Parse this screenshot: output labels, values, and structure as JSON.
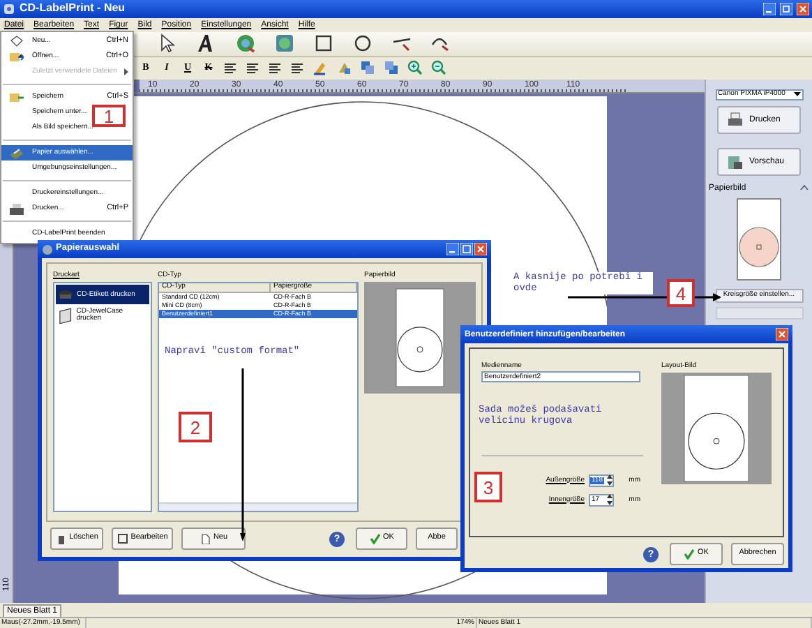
{
  "window": {
    "title": "CD-LabelPrint - Neu"
  },
  "menu_bar": [
    {
      "label": "Datei",
      "selected": true
    },
    {
      "label": "Bearbeiten",
      "selected": false
    },
    {
      "label": "Text",
      "selected": false
    },
    {
      "label": "Figur",
      "selected": false
    },
    {
      "label": "Bild",
      "selected": false
    },
    {
      "label": "Position",
      "selected": false
    },
    {
      "label": "Einstellungen",
      "selected": false
    },
    {
      "label": "Ansicht",
      "selected": false
    },
    {
      "label": "Hilfe",
      "selected": false
    }
  ],
  "file_menu": [
    {
      "kind": "item",
      "label": "Neu...",
      "shortcut": "Ctrl+N",
      "disabled": false,
      "selected": false,
      "submenu": false
    },
    {
      "kind": "item",
      "label": "Öffnen...",
      "shortcut": "Ctrl+O",
      "disabled": false,
      "selected": false,
      "submenu": false
    },
    {
      "kind": "item",
      "label": "Zuletzt verwendete Dateien",
      "disabled": true,
      "selected": false,
      "submenu": true
    },
    {
      "kind": "separator"
    },
    {
      "kind": "item",
      "label": "Speichern",
      "shortcut": "Ctrl+S",
      "disabled": false,
      "selected": false,
      "submenu": false
    },
    {
      "kind": "item",
      "label": "Speichern unter...",
      "disabled": false,
      "selected": false,
      "submenu": false
    },
    {
      "kind": "item",
      "label": "Als Bild speichern...",
      "disabled": false,
      "selected": false,
      "submenu": false
    },
    {
      "kind": "separator"
    },
    {
      "kind": "item",
      "label": "Papier auswählen...",
      "disabled": false,
      "selected": true,
      "submenu": false
    },
    {
      "kind": "item",
      "label": "Umgebungseinstellungen...",
      "disabled": false,
      "selected": false,
      "submenu": false
    },
    {
      "kind": "separator"
    },
    {
      "kind": "item",
      "label": "Druckereinstellungen...",
      "disabled": false,
      "selected": false,
      "submenu": false
    },
    {
      "kind": "item",
      "label": "Drucken...",
      "shortcut": "Ctrl+P",
      "disabled": false,
      "selected": false,
      "submenu": false
    },
    {
      "kind": "separator"
    },
    {
      "kind": "item",
      "label": "CD-LabelPrint beenden",
      "disabled": false,
      "selected": false,
      "submenu": false
    }
  ],
  "format_toolbar": [
    "B",
    "I",
    "U",
    "K"
  ],
  "ruler": {
    "ticks": [
      "10",
      "20",
      "30",
      "40",
      "50",
      "60",
      "70",
      "80",
      "90",
      "100",
      "110"
    ],
    "vertical_tick": "110"
  },
  "right_panel": {
    "printer": "Canon PIXMA iP4000",
    "print_button": "Drucken",
    "preview_button": "Vorschau",
    "paper_image_title": "Papierbild",
    "circle_size_button": "Kreisgröße einstellen..."
  },
  "paper_dialog": {
    "title": "Papierauswahl",
    "print_type_label": "Druckart",
    "print_types": [
      {
        "label": "CD-Etikett drucken",
        "selected": true
      },
      {
        "label": "CD-JewelCase drucken",
        "selected": false
      }
    ],
    "cd_type_label": "CD-Typ",
    "columns": [
      "CD-Typ",
      "Papiergröße"
    ],
    "rows": [
      {
        "cells": [
          "Standard CD (12cm)",
          "CD-R-Fach B"
        ],
        "selected": false
      },
      {
        "cells": [
          "Mini CD (8cm)",
          "CD-R-Fach B"
        ],
        "selected": false
      },
      {
        "cells": [
          "Benutzerdefiniert1",
          "CD-R-Fach B"
        ],
        "selected": true
      }
    ],
    "paper_image_label": "Papierbild",
    "buttons": {
      "delete": "Löschen",
      "edit": "Bearbeiten",
      "new": "Neu",
      "help": "?",
      "ok": "OK",
      "cancel": "Abbe"
    }
  },
  "custom_dialog": {
    "title": "Benutzerdefiniert hinzufügen/bearbeiten",
    "media_name_label": "Medienname",
    "media_name": "Benutzerdefiniert2",
    "layout_label": "Layout-Bild",
    "sizes": [
      {
        "label": "Außengröße",
        "value": "118",
        "unit": "mm",
        "selected": true
      },
      {
        "label": "Innengröße",
        "value": "17",
        "unit": "mm",
        "selected": false
      }
    ],
    "buttons": {
      "help": "?",
      "ok": "OK",
      "cancel": "Abbrechen"
    }
  },
  "annotations": [
    {
      "kind": "number",
      "text": "1"
    },
    {
      "kind": "note",
      "text": "Napravi \"custom format\""
    },
    {
      "kind": "number",
      "text": "2"
    },
    {
      "kind": "note",
      "text": "A kasnije po potrebi i ovde"
    },
    {
      "kind": "number",
      "text": "4"
    },
    {
      "kind": "note",
      "text": "Sada možeš podašavati velicinu krugova"
    },
    {
      "kind": "number",
      "text": "3"
    }
  ],
  "sheet_tab": "Neues Blatt 1",
  "status_bar": [
    "Maus(-27.2mm,-19.5mm)",
    "174%",
    "Neues Blatt 1"
  ]
}
